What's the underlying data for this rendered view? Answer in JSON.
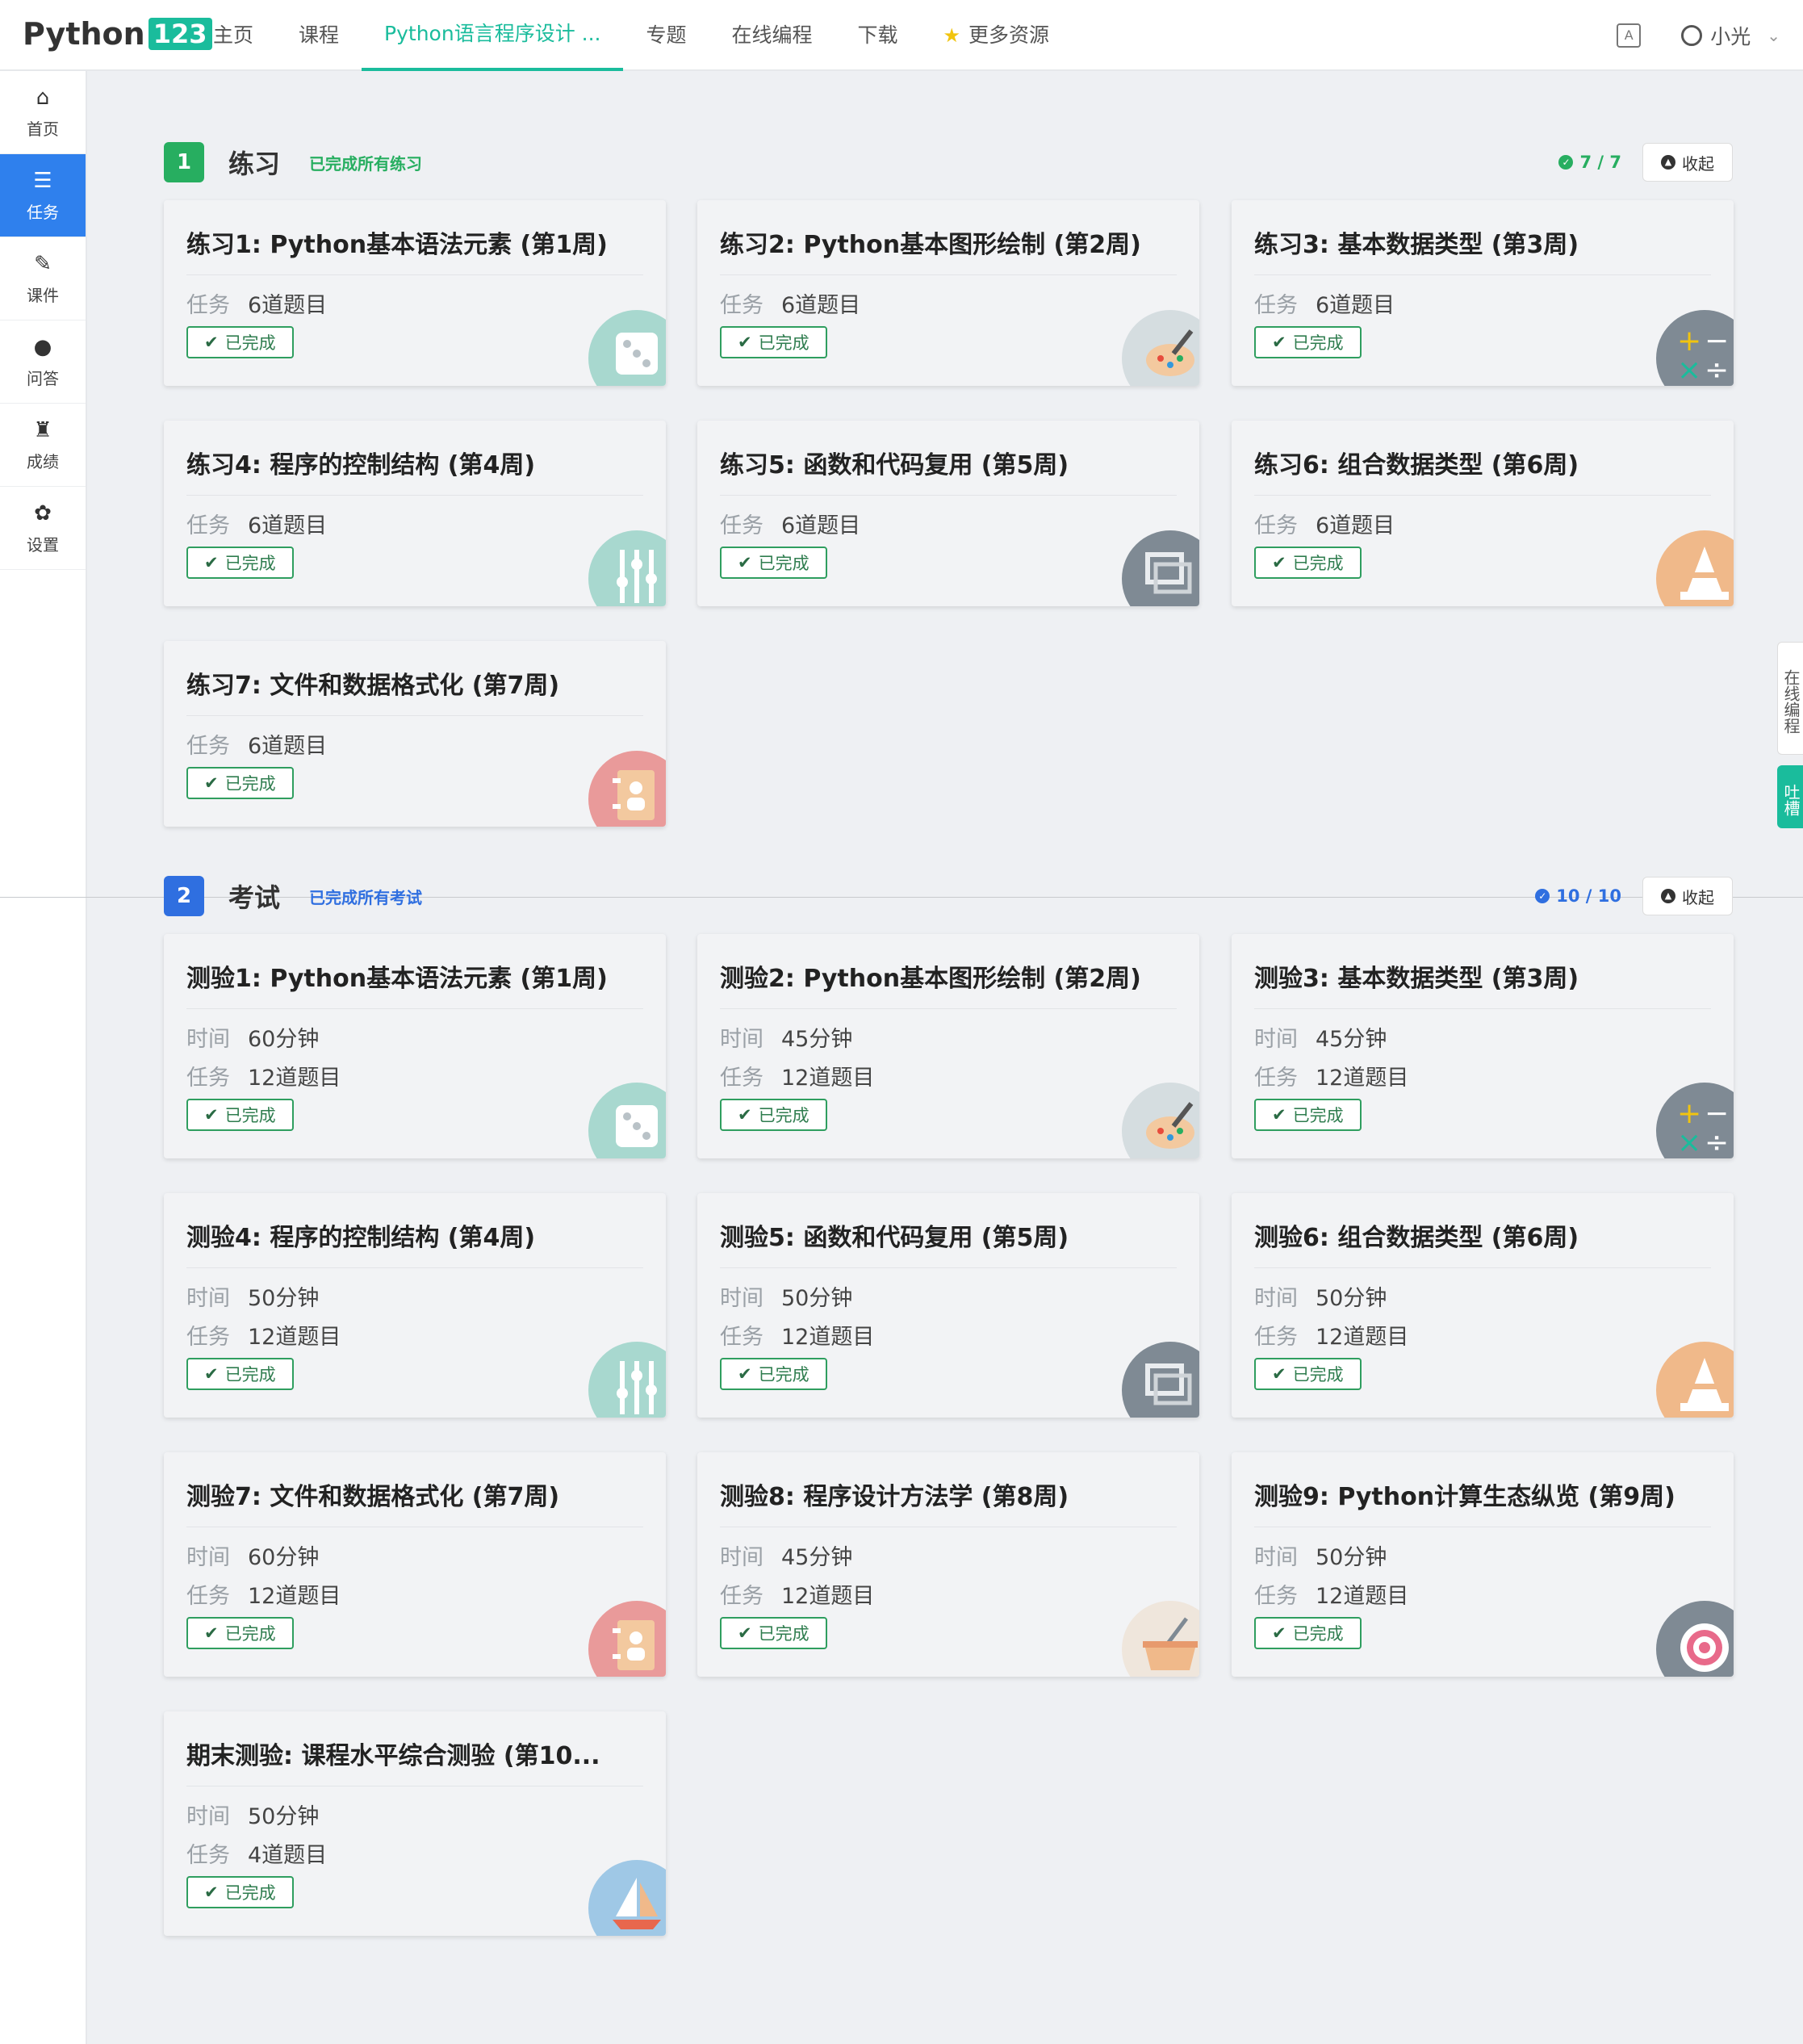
{
  "header": {
    "logo_text": "Python",
    "logo_num": "123",
    "nav": [
      "主页",
      "课程",
      "Python语言程序设计 ...",
      "专题",
      "在线编程",
      "下载"
    ],
    "more": "更多资源",
    "user": "小光"
  },
  "sidebar": {
    "items": [
      {
        "label": "首页",
        "icon": "home-icon"
      },
      {
        "label": "任务",
        "icon": "tasks-icon"
      },
      {
        "label": "课件",
        "icon": "paperclip-icon"
      },
      {
        "label": "问答",
        "icon": "comments-icon"
      },
      {
        "label": "成绩",
        "icon": "trophy-icon"
      },
      {
        "label": "设置",
        "icon": "gear-icon"
      }
    ]
  },
  "float": {
    "online": "在线编程",
    "feedback": "吐槽"
  },
  "sections": [
    {
      "num": "1",
      "title": "练习",
      "subtitle": "已完成所有练习",
      "count": "7 / 7",
      "collapse": "收起",
      "color": "#27ae60",
      "cards": [
        {
          "title": "练习1: Python基本语法元素 (第1周)",
          "task_label": "任务",
          "task": "6道题目",
          "status": "已完成",
          "icon": "dice-icon"
        },
        {
          "title": "练习2: Python基本图形绘制 (第2周)",
          "task_label": "任务",
          "task": "6道题目",
          "status": "已完成",
          "icon": "palette-icon"
        },
        {
          "title": "练习3: 基本数据类型 (第3周)",
          "task_label": "任务",
          "task": "6道题目",
          "status": "已完成",
          "icon": "calculator-icon"
        },
        {
          "title": "练习4: 程序的控制结构 (第4周)",
          "task_label": "任务",
          "task": "6道题目",
          "status": "已完成",
          "icon": "sliders-icon"
        },
        {
          "title": "练习5: 函数和代码复用 (第5周)",
          "task_label": "任务",
          "task": "6道题目",
          "status": "已完成",
          "icon": "windows-icon"
        },
        {
          "title": "练习6: 组合数据类型 (第6周)",
          "task_label": "任务",
          "task": "6道题目",
          "status": "已完成",
          "icon": "cone-icon"
        },
        {
          "title": "练习7: 文件和数据格式化 (第7周)",
          "task_label": "任务",
          "task": "6道题目",
          "status": "已完成",
          "icon": "contacts-icon"
        }
      ]
    },
    {
      "num": "2",
      "title": "考试",
      "subtitle": "已完成所有考试",
      "count": "10 / 10",
      "collapse": "收起",
      "color": "#2f6fe0",
      "cards": [
        {
          "title": "测验1: Python基本语法元素 (第1周)",
          "time_label": "时间",
          "time": "60分钟",
          "task_label": "任务",
          "task": "12道题目",
          "status": "已完成",
          "icon": "dice-icon"
        },
        {
          "title": "测验2: Python基本图形绘制 (第2周)",
          "time_label": "时间",
          "time": "45分钟",
          "task_label": "任务",
          "task": "12道题目",
          "status": "已完成",
          "icon": "palette-icon"
        },
        {
          "title": "测验3: 基本数据类型 (第3周)",
          "time_label": "时间",
          "time": "45分钟",
          "task_label": "任务",
          "task": "12道题目",
          "status": "已完成",
          "icon": "calculator-icon"
        },
        {
          "title": "测验4: 程序的控制结构 (第4周)",
          "time_label": "时间",
          "time": "50分钟",
          "task_label": "任务",
          "task": "12道题目",
          "status": "已完成",
          "icon": "sliders-icon"
        },
        {
          "title": "测验5: 函数和代码复用 (第5周)",
          "time_label": "时间",
          "time": "50分钟",
          "task_label": "任务",
          "task": "12道题目",
          "status": "已完成",
          "icon": "windows-icon"
        },
        {
          "title": "测验6: 组合数据类型 (第6周)",
          "time_label": "时间",
          "time": "50分钟",
          "task_label": "任务",
          "task": "12道题目",
          "status": "已完成",
          "icon": "cone-icon"
        },
        {
          "title": "测验7: 文件和数据格式化 (第7周)",
          "time_label": "时间",
          "time": "60分钟",
          "task_label": "任务",
          "task": "12道题目",
          "status": "已完成",
          "icon": "contacts-icon"
        },
        {
          "title": "测验8: 程序设计方法学 (第8周)",
          "time_label": "时间",
          "time": "45分钟",
          "task_label": "任务",
          "task": "12道题目",
          "status": "已完成",
          "icon": "basket-icon"
        },
        {
          "title": "测验9: Python计算生态纵览 (第9周)",
          "time_label": "时间",
          "time": "50分钟",
          "task_label": "任务",
          "task": "12道题目",
          "status": "已完成",
          "icon": "target-icon"
        },
        {
          "title": "期末测验: 课程水平综合测验 (第10...",
          "time_label": "时间",
          "time": "50分钟",
          "task_label": "任务",
          "task": "4道题目",
          "status": "已完成",
          "icon": "sailboat-icon"
        }
      ]
    }
  ]
}
